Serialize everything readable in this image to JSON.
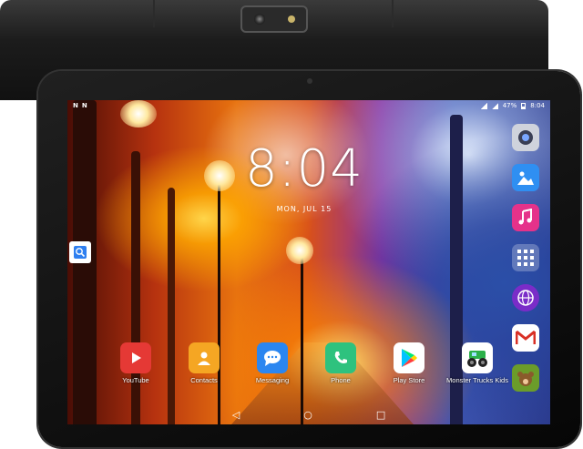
{
  "status_bar": {
    "left_icons": [
      "N",
      "N"
    ],
    "battery_percent": "47%",
    "time": "8:04"
  },
  "lockscreen": {
    "clock": "8:04",
    "date": "MON, JUL 15"
  },
  "search_widget": {
    "icon": "search-icon"
  },
  "right_dock": [
    {
      "name": "camera",
      "icon": "camera-icon",
      "color": "#cfd3dc"
    },
    {
      "name": "gallery",
      "icon": "gallery-icon",
      "color": "#2f8ff2"
    },
    {
      "name": "music",
      "icon": "music-icon",
      "color": "#e5328a"
    },
    {
      "name": "all-apps",
      "icon": "grid-icon",
      "color": "#ffffff"
    },
    {
      "name": "browser",
      "icon": "globe-icon",
      "color": "#7a2cc8"
    },
    {
      "name": "gmail",
      "icon": "mail-icon",
      "color": "#ffffff"
    },
    {
      "name": "kids-game",
      "icon": "bear-icon",
      "color": "#6b9c2a"
    }
  ],
  "apps": [
    {
      "label": "YouTube",
      "icon": "youtube-icon",
      "color": "#e53935"
    },
    {
      "label": "Contacts",
      "icon": "contacts-icon",
      "color": "#f5a623"
    },
    {
      "label": "Messaging",
      "icon": "message-icon",
      "color": "#2b86f0"
    },
    {
      "label": "Phone",
      "icon": "phone-icon",
      "color": "#2ec27e"
    },
    {
      "label": "Play Store",
      "icon": "play-store-icon",
      "color": "#ffffff"
    },
    {
      "label": "Monster Trucks Kids",
      "icon": "truck-icon",
      "color": "#ffffff"
    }
  ],
  "nav_bar": {
    "back": "◁",
    "home": "○",
    "recents": "□"
  }
}
